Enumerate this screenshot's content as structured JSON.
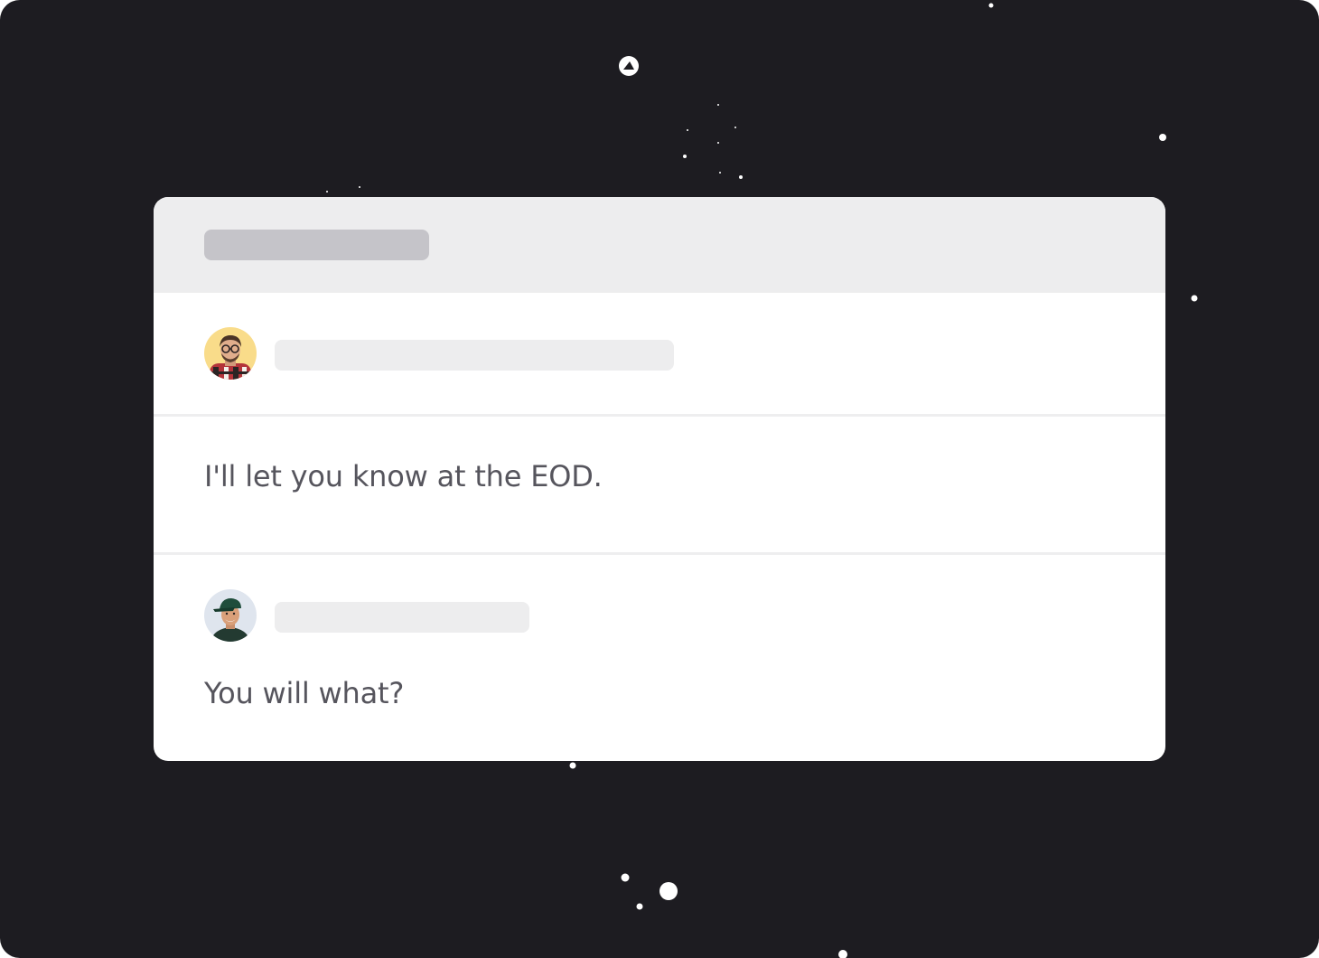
{
  "thread": {
    "messages": [
      {
        "avatar_icon": "person-glasses-plaid-shirt-avatar",
        "text": "I'll let you know at the EOD."
      },
      {
        "avatar_icon": "person-green-cap-avatar",
        "text": "You will what?"
      }
    ]
  },
  "colors": {
    "background": "#1d1c21",
    "card": "#ffffff",
    "header": "#ededee",
    "skeleton_dark": "#c5c4c9",
    "skeleton_light": "#ededee",
    "text": "#56555d"
  }
}
